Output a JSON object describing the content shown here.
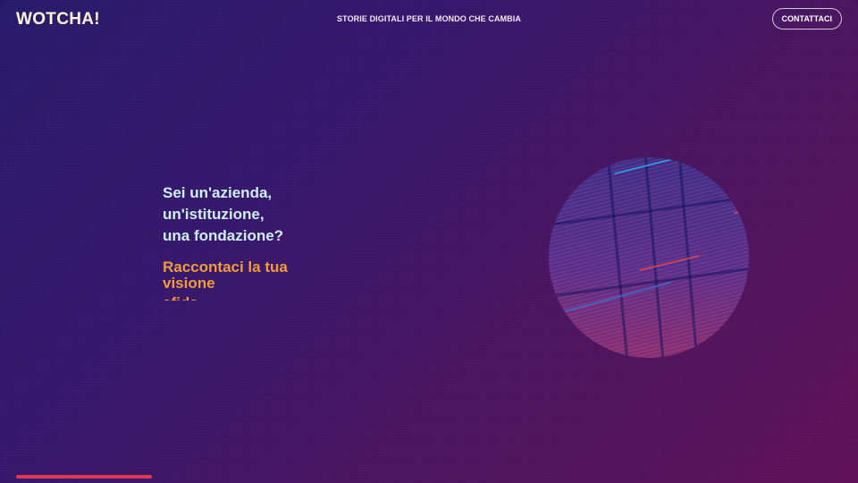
{
  "header": {
    "logo": "WOTCHA!",
    "tagline": "STORIE DIGITALI PER IL MONDO CHE CAMBIA",
    "contact_label": "CONTATTACI"
  },
  "hero": {
    "question_lines": [
      "Sei un'azienda,",
      "un'istituzione,",
      "una fondazione?"
    ],
    "answer_line_1": "Raccontaci la tua",
    "answer_line_2": "visione",
    "answer_line_3": "sfida"
  },
  "progress": {
    "fraction": 1.0
  },
  "colors": {
    "accent_orange": "#f29a3e",
    "question_text": "#cfeefa",
    "progress_red": "#e03a52",
    "logo_cream": "#fff4da"
  },
  "decor": {
    "globe": "striped-globe-graphic"
  }
}
